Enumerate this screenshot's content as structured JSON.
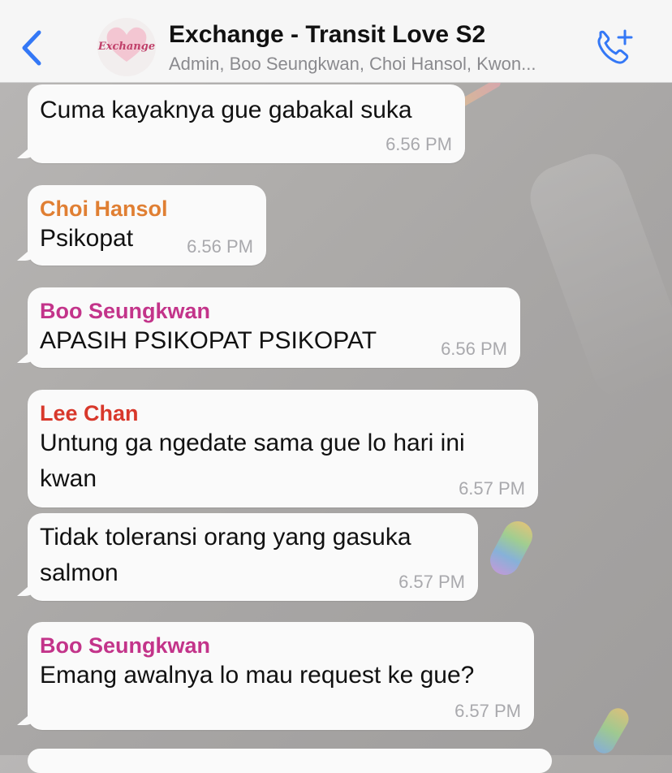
{
  "header": {
    "back_label": "Back",
    "title": "Exchange - Transit Love S2",
    "members": "Admin, Boo Seungkwan, Choi Hansol, Kwon...",
    "avatar_text": "Exchange"
  },
  "colors": {
    "accent": "#3478f6",
    "choi_hansol": "#e07f33",
    "boo_seungkwan": "#c3348a",
    "lee_chan": "#d8382b"
  },
  "messages": [
    {
      "sender": "",
      "text": "Cuma kayaknya gue gabakal suka",
      "time": "6.56 PM"
    },
    {
      "sender": "Choi Hansol",
      "text": "Psikopat",
      "time": "6.56 PM"
    },
    {
      "sender": "Boo Seungkwan",
      "text": "APASIH PSIKOPAT PSIKOPAT",
      "time": "6.56 PM"
    },
    {
      "sender": "Lee Chan",
      "text": "Untung ga ngedate sama gue lo hari ini kwan",
      "time": "6.57 PM"
    },
    {
      "sender": "",
      "text": "Tidak toleransi orang yang gasuka salmon",
      "time": "6.57 PM"
    },
    {
      "sender": "Boo Seungkwan",
      "text": "Emang awalnya lo mau request ke gue?",
      "time": "6.57 PM"
    }
  ]
}
